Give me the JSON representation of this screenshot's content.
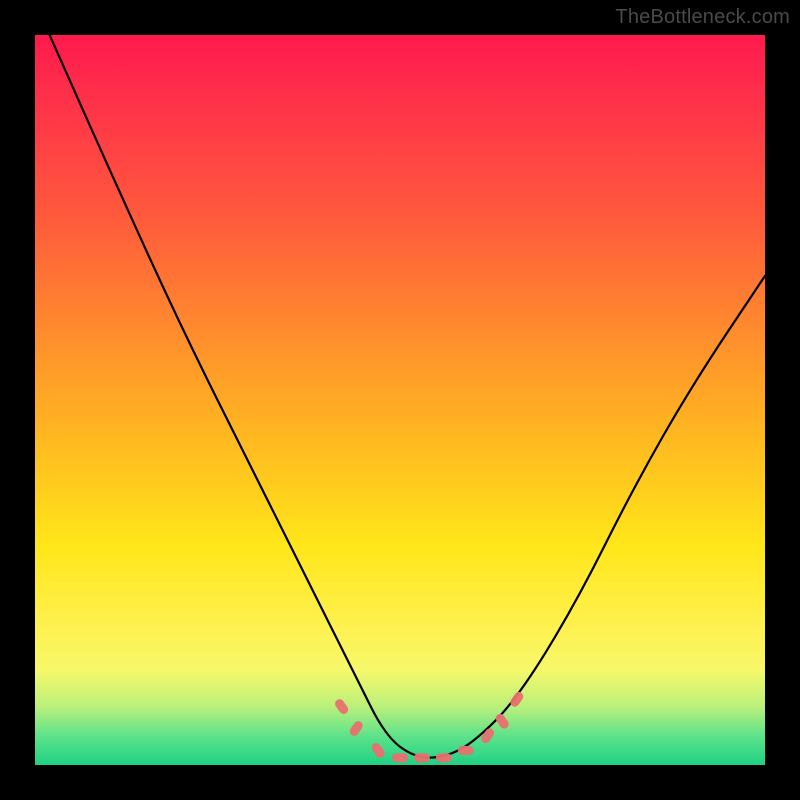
{
  "watermark": "TheBottleneck.com",
  "chart_data": {
    "type": "line",
    "title": "",
    "xlabel": "",
    "ylabel": "",
    "xlim": [
      0,
      100
    ],
    "ylim": [
      0,
      100
    ],
    "grid": false,
    "legend": false,
    "series": [
      {
        "name": "bottleneck-curve",
        "x": [
          2,
          10,
          20,
          30,
          38,
          44,
          48,
          52,
          56,
          60,
          66,
          74,
          82,
          90,
          100
        ],
        "y": [
          100,
          82,
          60,
          40,
          24,
          12,
          4,
          1,
          1,
          3,
          9,
          22,
          38,
          52,
          67
        ]
      }
    ],
    "markers": {
      "name": "trough-highlight",
      "color": "#e97070",
      "points": [
        {
          "x": 42,
          "y": 8
        },
        {
          "x": 44,
          "y": 5
        },
        {
          "x": 47,
          "y": 2
        },
        {
          "x": 50,
          "y": 1
        },
        {
          "x": 53,
          "y": 1
        },
        {
          "x": 56,
          "y": 1
        },
        {
          "x": 59,
          "y": 2
        },
        {
          "x": 62,
          "y": 4
        },
        {
          "x": 64,
          "y": 6
        },
        {
          "x": 66,
          "y": 9
        }
      ]
    },
    "gradient_stops": [
      {
        "pos": 0,
        "color": "#ff1a4d"
      },
      {
        "pos": 25,
        "color": "#ff5a3c"
      },
      {
        "pos": 55,
        "color": "#ffb820"
      },
      {
        "pos": 80,
        "color": "#f6f86a"
      },
      {
        "pos": 100,
        "color": "#1fd184"
      }
    ]
  }
}
